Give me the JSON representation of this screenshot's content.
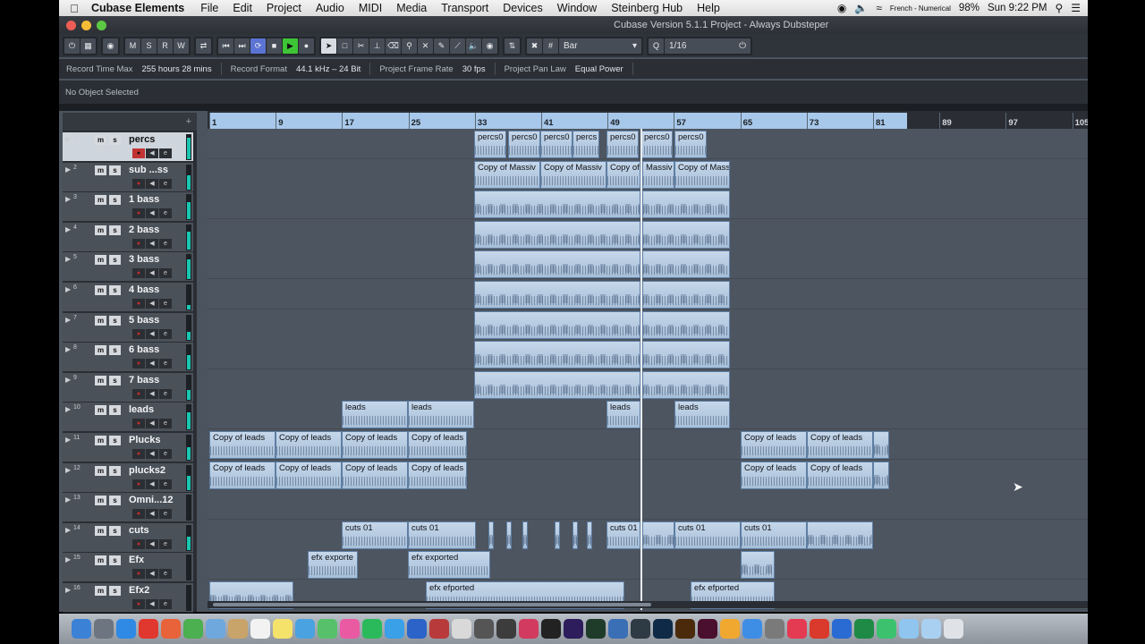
{
  "menubar": {
    "app_name": "Cubase Elements",
    "items": [
      "File",
      "Edit",
      "Project",
      "Audio",
      "MIDI",
      "Media",
      "Transport",
      "Devices",
      "Window",
      "Steinberg Hub",
      "Help"
    ],
    "input_source": "French - Numerical",
    "battery": "98%",
    "clock": "Sun 9:22 PM"
  },
  "window": {
    "title": "Cubase Version 5.1.1 Project - Always Dubsteper"
  },
  "toolbar": {
    "mode_buttons": [
      "M",
      "S",
      "R",
      "W"
    ],
    "snap_type": "Bar",
    "quantize": "1/16"
  },
  "infoline": {
    "record_time_label": "Record Time Max",
    "record_time_value": "255 hours 28 mins",
    "record_format_label": "Record Format",
    "record_format_value": "44.1 kHz – 24 Bit",
    "frame_rate_label": "Project Frame Rate",
    "frame_rate_value": "30 fps",
    "pan_law_label": "Project Pan Law",
    "pan_law_value": "Equal Power"
  },
  "object_selection": "No Object Selected",
  "ruler": {
    "bars": [
      "1",
      "9",
      "17",
      "25",
      "33",
      "41",
      "49",
      "57",
      "65",
      "73",
      "81",
      "89",
      "97",
      "105"
    ]
  },
  "tracks": [
    {
      "num": "1",
      "name": "percs",
      "selected": true,
      "meter": 0.9
    },
    {
      "num": "2",
      "name": "sub ...ss",
      "meter": 0.6
    },
    {
      "num": "3",
      "name": "1 bass",
      "meter": 0.7
    },
    {
      "num": "4",
      "name": "2 bass",
      "meter": 0.75
    },
    {
      "num": "5",
      "name": "3 bass",
      "meter": 0.8
    },
    {
      "num": "6",
      "name": "4 bass",
      "meter": 0.2
    },
    {
      "num": "7",
      "name": "5 bass",
      "meter": 0.35
    },
    {
      "num": "8",
      "name": "6 bass",
      "meter": 0.6
    },
    {
      "num": "9",
      "name": "7 bass",
      "meter": 0.4
    },
    {
      "num": "10",
      "name": "leads",
      "meter": 0.7
    },
    {
      "num": "11",
      "name": "Plucks",
      "meter": 0.5
    },
    {
      "num": "12",
      "name": "plucks2",
      "meter": 0.6
    },
    {
      "num": "13",
      "name": "Omni...12",
      "meter": 0.0
    },
    {
      "num": "14",
      "name": "cuts",
      "meter": 0.55
    },
    {
      "num": "15",
      "name": "Efx",
      "meter": 0.0
    },
    {
      "num": "16",
      "name": "Efx2",
      "meter": 0.0
    }
  ],
  "track_controls": {
    "mute": "m",
    "solo": "s",
    "record": "●",
    "monitor": "◀",
    "edit": "e"
  },
  "events": {
    "track_1": [
      "percs0",
      "percs0",
      "percs0",
      "percs",
      "percs0",
      "percs0",
      "percs0"
    ],
    "track_2": [
      "Copy of Massiv",
      "Copy of Massiv",
      "Copy of",
      "Massiv",
      "Copy of Mass"
    ],
    "track_10": [
      "leads",
      "leads",
      "leads",
      "leads"
    ],
    "track_11": [
      "Copy of leads",
      "Copy of leads",
      "Copy of leads",
      "Copy of leads",
      "Copy of leads",
      "Copy of leads"
    ],
    "track_12": [
      "Copy of leads",
      "Copy of leads",
      "Copy of leads",
      "Copy of leads",
      "Copy of leads",
      "Copy of leads"
    ],
    "track_14": [
      "cuts 01",
      "cuts 01",
      "cuts 01",
      "cuts 01",
      "cuts 01"
    ],
    "track_15": [
      "efx exporte",
      "efx exported"
    ],
    "track_16": [
      "efx efported",
      "efx efported"
    ]
  }
}
